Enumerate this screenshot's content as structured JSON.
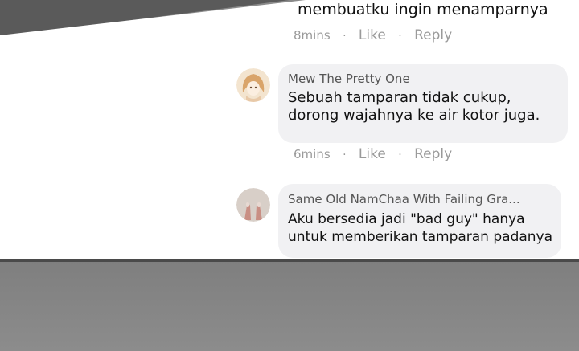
{
  "comments": [
    {
      "text_lines": [
        "membuatku ingin menamparnya"
      ],
      "time": "8mins",
      "like": "Like",
      "reply": "Reply"
    },
    {
      "author": "Mew The Pretty One",
      "text_lines": [
        "Sebuah tamparan tidak cukup,",
        "dorong wajahnya ke air kotor juga."
      ],
      "time": "6mins",
      "like": "Like",
      "reply": "Reply"
    },
    {
      "author": "Same Old NamChaa With Failing Gra...",
      "text_lines": [
        "Aku bersedia jadi \"bad guy\" hanya",
        "untuk memberikan tamparan padanya"
      ]
    }
  ],
  "separator": "·",
  "colors": {
    "bubble": "#f1f1f3",
    "meta_text": "#9a9a9a",
    "name_text": "#555555",
    "body_text": "#111111"
  }
}
